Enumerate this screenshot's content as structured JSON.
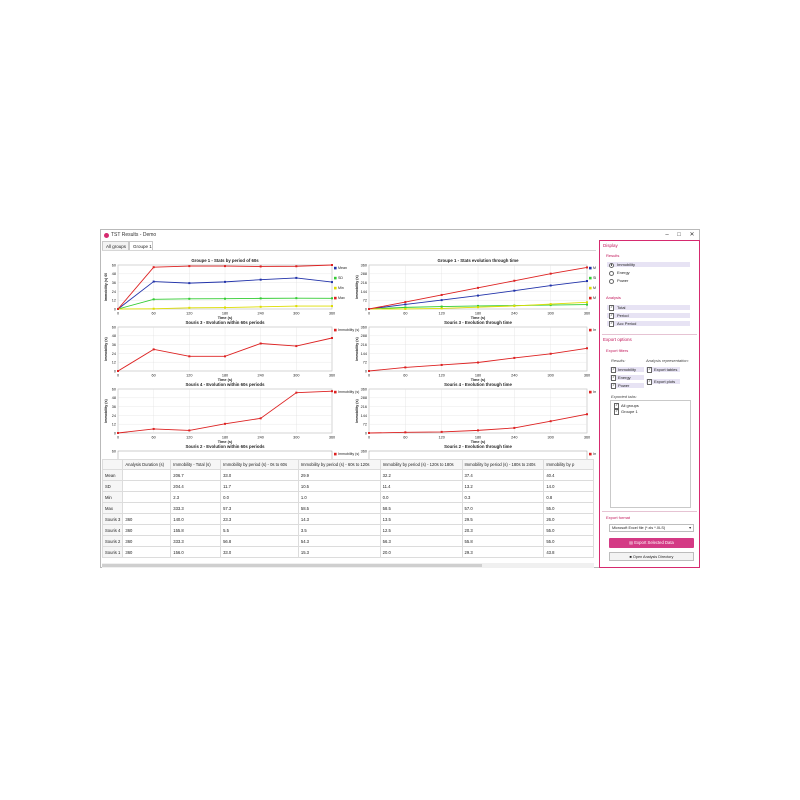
{
  "window": {
    "title": "TST Results - Demo"
  },
  "tabs": [
    {
      "label": "All groups"
    },
    {
      "label": "Groupe 1"
    }
  ],
  "charts": [
    {
      "title": "Groupe 1 - Stats by period of 60s",
      "xlabel": "Time (s)",
      "ylabel": "Immobility (s) 60",
      "yticks": [
        "60",
        "48",
        "36",
        "24",
        "12",
        "0"
      ],
      "xticks": [
        "0",
        "60",
        "120",
        "180",
        "240",
        "300",
        "360"
      ],
      "legend": [
        "Mean",
        "SD",
        "Min",
        "Max"
      ]
    },
    {
      "title": "Groupe 1 - Stats evolution through time",
      "xlabel": "Time (s)",
      "ylabel": "Immobility (s)",
      "yticks": [
        "360",
        "288",
        "216",
        "144",
        "72",
        "0"
      ],
      "xticks": [
        "0",
        "60",
        "120",
        "180",
        "240",
        "300",
        "360"
      ],
      "legend": [
        "Mean",
        "SD",
        "Min",
        "Max"
      ]
    },
    {
      "title": "Souris 3 - Evolution within 60s periods",
      "xlabel": "Time (s)",
      "ylabel": "Immobility (s)",
      "yticks": [
        "60",
        "48",
        "36",
        "24",
        "12",
        "0"
      ],
      "xticks": [
        "0",
        "60",
        "120",
        "180",
        "240",
        "300",
        "360"
      ],
      "legend": [
        "Immobility (s)"
      ]
    },
    {
      "title": "Souris 3 - Evolution through time",
      "xlabel": "Time (s)",
      "ylabel": "Immobility (s)",
      "yticks": [
        "360",
        "288",
        "216",
        "144",
        "72",
        "0"
      ],
      "xticks": [
        "0",
        "60",
        "120",
        "180",
        "240",
        "300",
        "360"
      ],
      "legend": [
        "Immobility (s)"
      ]
    },
    {
      "title": "Souris 4 - Evolution within 60s periods",
      "xlabel": "Time (s)",
      "ylabel": "Immobility (s)",
      "yticks": [
        "60",
        "48",
        "36",
        "24",
        "12",
        "0"
      ],
      "xticks": [
        "0",
        "60",
        "120",
        "180",
        "240",
        "300",
        "360"
      ],
      "legend": [
        "Immobility (s)"
      ]
    },
    {
      "title": "Souris 4 - Evolution through time",
      "xlabel": "Time (s)",
      "ylabel": "Immobility (s)",
      "yticks": [
        "360",
        "288",
        "216",
        "144",
        "72",
        "0"
      ],
      "xticks": [
        "0",
        "60",
        "120",
        "180",
        "240",
        "300",
        "360"
      ],
      "legend": [
        "Immobility (s)"
      ]
    },
    {
      "title": "Souris 2 - Evolution within 60s periods",
      "xlabel": "",
      "ylabel": "",
      "yticks": [
        "60"
      ],
      "xticks": [],
      "legend": [
        "Immobility (s)"
      ]
    },
    {
      "title": "Souris 2 - Evolution through time",
      "xlabel": "",
      "ylabel": "",
      "yticks": [
        "360"
      ],
      "xticks": [],
      "legend": [
        "Immobility (s)"
      ]
    }
  ],
  "chart_data": [
    {
      "type": "line",
      "title": "Groupe 1 - Stats by period of 60s",
      "xlabel": "Time (s)",
      "ylabel": "Immobility (s) 60",
      "x": [
        0,
        60,
        120,
        180,
        240,
        300,
        360
      ],
      "ylim": [
        0,
        60
      ],
      "series": [
        {
          "name": "Mean",
          "color": "#2233aa",
          "values": [
            0,
            37.4,
            35.3,
            37.0,
            40.0,
            42.4,
            36.7
          ]
        },
        {
          "name": "SD",
          "color": "#33cc33",
          "values": [
            0,
            13.2,
            13.9,
            14.0,
            14.5,
            14.8,
            14.6
          ]
        },
        {
          "name": "Min",
          "color": "#dddd00",
          "values": [
            0,
            0.3,
            1.6,
            2.0,
            3.0,
            4.0,
            4.0
          ]
        },
        {
          "name": "Max",
          "color": "#dd2222",
          "values": [
            0,
            57.0,
            58.5,
            58.5,
            58.0,
            58.3,
            60.0
          ]
        }
      ]
    },
    {
      "type": "line",
      "title": "Groupe 1 - Stats evolution through time",
      "xlabel": "Time (s)",
      "ylabel": "Immobility (s)",
      "x": [
        0,
        60,
        120,
        180,
        240,
        300,
        360
      ],
      "ylim": [
        0,
        360
      ],
      "series": [
        {
          "name": "Mean",
          "color": "#2233aa",
          "values": [
            0,
            37.4,
            72.7,
            109.7,
            149.7,
            192.1,
            228.8
          ]
        },
        {
          "name": "SD",
          "color": "#33cc33",
          "values": [
            0,
            13.2,
            20.0,
            25.0,
            28.0,
            32.0,
            36.0
          ]
        },
        {
          "name": "Min",
          "color": "#dddd00",
          "values": [
            0,
            0.3,
            5.0,
            15.0,
            25.0,
            40.0,
            55.0
          ]
        },
        {
          "name": "Max",
          "color": "#dd2222",
          "values": [
            0,
            57.0,
            115.0,
            173.0,
            231.0,
            289.0,
            340.0
          ]
        }
      ]
    },
    {
      "type": "line",
      "title": "Souris 3 - Evolution within 60s periods",
      "xlabel": "Time (s)",
      "ylabel": "Immobility (s)",
      "x": [
        0,
        60,
        120,
        180,
        240,
        300,
        360
      ],
      "ylim": [
        0,
        60
      ],
      "series": [
        {
          "name": "Immobility (s)",
          "color": "#dd2222",
          "values": [
            0,
            29.5,
            20.0,
            20.0,
            37.5,
            34.0,
            45.0
          ]
        }
      ]
    },
    {
      "type": "line",
      "title": "Souris 3 - Evolution through time",
      "xlabel": "Time (s)",
      "ylabel": "Immobility (s)",
      "x": [
        0,
        60,
        120,
        180,
        240,
        300,
        360
      ],
      "ylim": [
        0,
        360
      ],
      "series": [
        {
          "name": "Immobility (s)",
          "color": "#dd2222",
          "values": [
            0,
            29.5,
            49.5,
            69.5,
            107.0,
            141.0,
            186.0
          ]
        }
      ]
    },
    {
      "type": "line",
      "title": "Souris 4 - Evolution within 60s periods",
      "xlabel": "Time (s)",
      "ylabel": "Immobility (s)",
      "x": [
        0,
        60,
        120,
        180,
        240,
        300,
        360
      ],
      "ylim": [
        0,
        60
      ],
      "series": [
        {
          "name": "Immobility (s)",
          "color": "#dd2222",
          "values": [
            0,
            5.5,
            3.5,
            12.5,
            20.0,
            55.0,
            57.0
          ]
        }
      ]
    },
    {
      "type": "line",
      "title": "Souris 4 - Evolution through time",
      "xlabel": "Time (s)",
      "ylabel": "Immobility (s)",
      "x": [
        0,
        60,
        120,
        180,
        240,
        300,
        360
      ],
      "ylim": [
        0,
        360
      ],
      "series": [
        {
          "name": "Immobility (s)",
          "color": "#dd2222",
          "values": [
            0,
            5.5,
            9.0,
            21.5,
            41.5,
            96.5,
            153.5
          ]
        }
      ]
    }
  ],
  "table": {
    "headers": [
      "",
      "Analysis Duration (s)",
      "Immobility - Total (s)",
      "Immobility by period (s) - 0s to 60s",
      "Immobility by period (s) - 60s to 120s",
      "Immobility by period (s) - 120s to 180s",
      "Immobility by period (s) - 180s to 240s",
      "Immobility by p"
    ],
    "rows": [
      [
        "Mean",
        "",
        "206.7",
        "33.0",
        "29.9",
        "32.2",
        "37.4",
        "40.4"
      ],
      [
        "SD",
        "",
        "204.4",
        "11.7",
        "10.5",
        "11.4",
        "13.2",
        "14.0"
      ],
      [
        "Min",
        "",
        "2.3",
        "0.0",
        "1.0",
        "0.0",
        "0.3",
        "0.8"
      ],
      [
        "Max",
        "",
        "333.3",
        "57.3",
        "58.5",
        "58.5",
        "57.0",
        "55.0"
      ],
      [
        "Souris 3",
        "360",
        "140.0",
        "23.3",
        "14.3",
        "13.5",
        "29.5",
        "26.0"
      ],
      [
        "Souris 4",
        "360",
        "155.8",
        "5.5",
        "3.5",
        "12.5",
        "20.3",
        "55.0"
      ],
      [
        "Souris 2",
        "360",
        "333.3",
        "56.8",
        "54.3",
        "56.3",
        "55.8",
        "55.0"
      ],
      [
        "Souris 1",
        "360",
        "156.0",
        "33.0",
        "15.3",
        "20.0",
        "29.3",
        "43.8"
      ]
    ]
  },
  "panel": {
    "display_title": "Display",
    "results_label": "Results",
    "results_options": [
      "Immobility",
      "Energy",
      "Power"
    ],
    "analysis_label": "Analysis",
    "analysis_options": [
      "Total",
      "Period",
      "Acc Period"
    ],
    "export_options_title": "Export options",
    "export_filters_label": "Export filters",
    "results_sub": "Results:",
    "analysis_repr_sub": "Analysis representation:",
    "export_results": [
      "Immobility",
      "Energy",
      "Power"
    ],
    "export_repr": [
      "Export tables",
      "Export plots"
    ],
    "exported_tabs_label": "Exported tabs:",
    "exported_tabs": [
      "All groups",
      "Groupe 1"
    ],
    "export_format_label": "Export format",
    "export_format_value": "Microsoft Excel file (*.xls *.XLS)",
    "export_button": "Export Selected Data",
    "open_dir_button": "Open Analysis Directory"
  }
}
